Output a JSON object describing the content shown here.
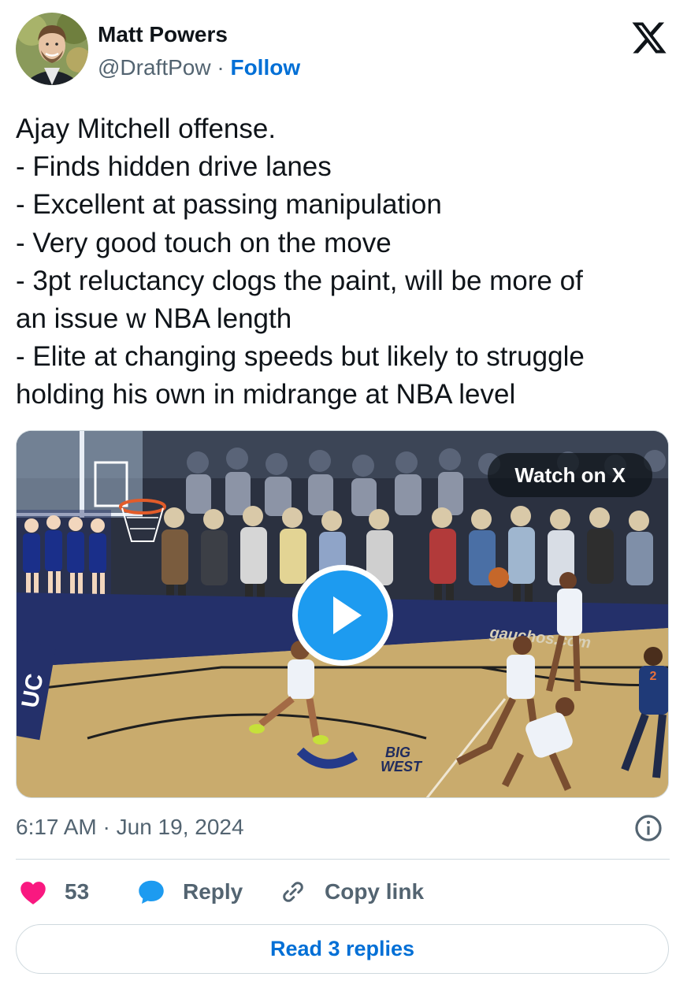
{
  "author": {
    "name": "Matt Powers",
    "handle": "@DraftPow",
    "separator": "·",
    "follow_label": "Follow",
    "avatar_icon": "user-avatar-photo"
  },
  "brand_icon": "x-logo-icon",
  "tweet": {
    "lines": [
      "Ajay Mitchell offense.",
      "- Finds hidden drive lanes",
      "- Excellent at passing manipulation",
      "- Very good touch on the move",
      "- 3pt reluctancy clogs the paint, will be more of",
      "an issue w NBA length",
      "- Elite at changing speeds but likely to struggle",
      "holding his own in midrange at NBA level"
    ]
  },
  "media": {
    "watch_label": "Watch on X",
    "play_icon": "play-icon",
    "court_text_1": "BIG",
    "court_text_2": "WEST",
    "court_text_3": "gauchos.com",
    "court_text_4": "UC",
    "jersey_number": "2"
  },
  "meta": {
    "time": "6:17 AM",
    "separator": "·",
    "date": "Jun 19, 2024",
    "info_icon": "info-icon"
  },
  "actions": {
    "like_count": "53",
    "reply_label": "Reply",
    "copy_label": "Copy link"
  },
  "read_replies_label": "Read 3 replies",
  "colors": {
    "accent": "#006fd6",
    "like": "#f91880",
    "reply_bubble": "#1d9bf0",
    "muted": "#536471",
    "border": "#cfd9de"
  }
}
